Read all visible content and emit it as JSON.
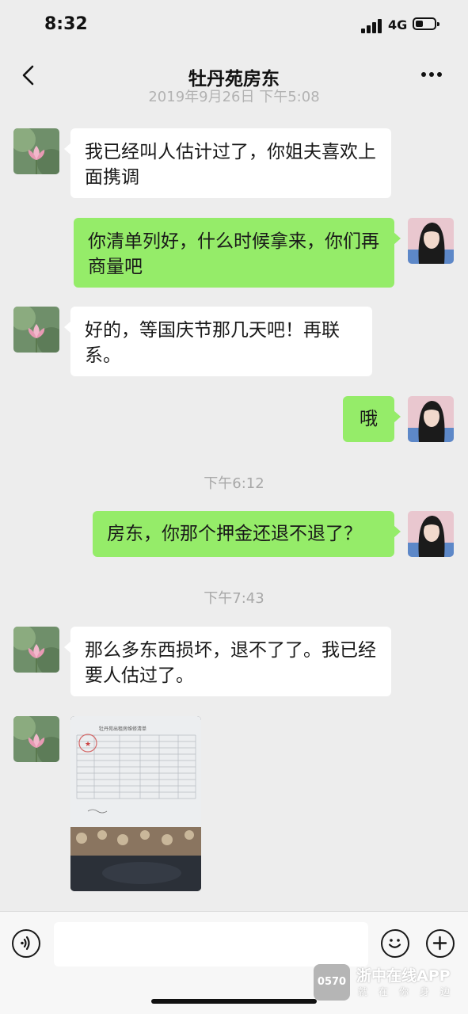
{
  "status_bar": {
    "time": "8:32",
    "network": "4G"
  },
  "header": {
    "title": "牡丹苑房东"
  },
  "partial_timestamp": "2019年9月26日 下午5:08",
  "messages": [
    {
      "from": "landlord",
      "text": "我已经叫人估计过了，你姐夫喜欢上面携调"
    },
    {
      "from": "me",
      "text": "你清单列好，什么时候拿来，你们再商量吧"
    },
    {
      "from": "landlord",
      "text": "好的，等国庆节那几天吧！再联系。"
    },
    {
      "from": "me",
      "text": "哦"
    },
    {
      "timestamp": "下午6:12"
    },
    {
      "from": "me",
      "text": "房东，你那个押金还退不退了？"
    },
    {
      "timestamp": "下午7:43"
    },
    {
      "from": "landlord",
      "text": "那么多东西损坏，退不了了。我已经要人估过了。"
    },
    {
      "from": "landlord",
      "type": "image",
      "image_title": "牡丹苑出租房维修清单"
    }
  ],
  "input": {
    "placeholder": ""
  },
  "icons": {
    "back": "chevron-left-icon",
    "more": "more-dots-icon",
    "voice": "voice-icon",
    "emoji": "emoji-icon",
    "add": "plus-icon"
  },
  "watermark": {
    "logo": "0570",
    "name": "浙中在线APP",
    "slogan": "就在你身边"
  },
  "colors": {
    "background": "#ededed",
    "outgoing_bubble": "#95ec69",
    "incoming_bubble": "#ffffff"
  }
}
